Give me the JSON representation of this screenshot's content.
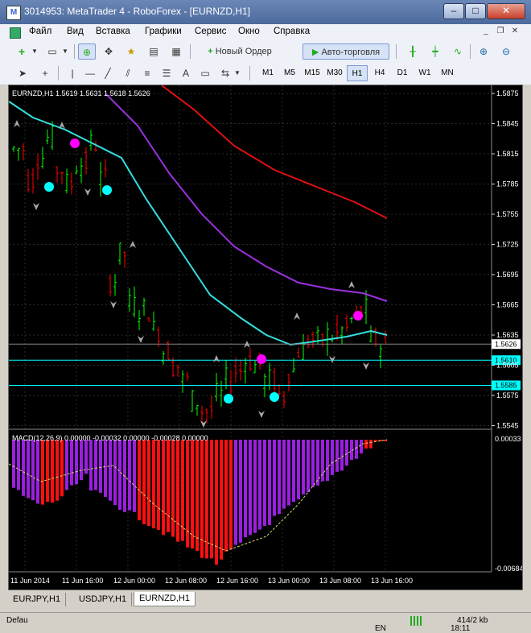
{
  "window": {
    "title": "3014953: MetaTrader 4 - RoboForex - [EURNZD,H1]",
    "min_label": "–",
    "max_label": "□",
    "close_label": "✕"
  },
  "menu": {
    "items": [
      "Файл",
      "Вид",
      "Вставка",
      "Графики",
      "Сервис",
      "Окно",
      "Справка"
    ]
  },
  "toolbar": {
    "new_order_label": "Новый Ордер",
    "autotrading_label": "Авто-торговля"
  },
  "timeframes": [
    "M1",
    "M5",
    "M15",
    "M30",
    "H1",
    "H4",
    "D1",
    "W1",
    "MN"
  ],
  "active_timeframe": "H1",
  "chart": {
    "info": "EURNZD,H1  1.5619 1.5631 1.5618 1.5626",
    "price_labels": [
      "1.5875",
      "1.5845",
      "1.5815",
      "1.5785",
      "1.5755",
      "1.5725",
      "1.5695",
      "1.5665",
      "1.5635",
      "1.5605",
      "1.5575",
      "1.5545"
    ],
    "current_price": "1.5626",
    "hline1_label": "1.5610",
    "hline2_label": "1.5585",
    "time_labels": [
      "11 Jun 2014",
      "11 Jun 16:00",
      "12 Jun 00:00",
      "12 Jun 08:00",
      "12 Jun 16:00",
      "13 Jun 00:00",
      "13 Jun 08:00",
      "13 Jun 16:00"
    ],
    "colors": {
      "background": "#000000",
      "bull": "#00ff00",
      "bear": "#ff0000",
      "ma_fast": "#33e0e0",
      "ma_mid": "#9b30e0",
      "ma_slow": "#e01010",
      "hline": "#00ffff",
      "dot_cyan": "#00ffff",
      "dot_magenta": "#ff00ff",
      "fractal": "#a8a8a8"
    }
  },
  "macd": {
    "info": "MACD(12,26,9) 0.00000 -0.00032 0.00000 -0.00028 0.00000",
    "top_label": "0.00033",
    "bottom_label": "-0.00684",
    "colors": {
      "up": "#9b1fe0",
      "down": "#ff1010",
      "signal": "#c8e06a"
    }
  },
  "tabs": [
    "EURJPY,H1",
    "USDJPY,H1",
    "EURNZD,H1"
  ],
  "active_tab": "EURNZD,H1",
  "status": {
    "left": "Defau",
    "traffic": "414/2 kb",
    "lang": "EN",
    "time": "18:11"
  }
}
